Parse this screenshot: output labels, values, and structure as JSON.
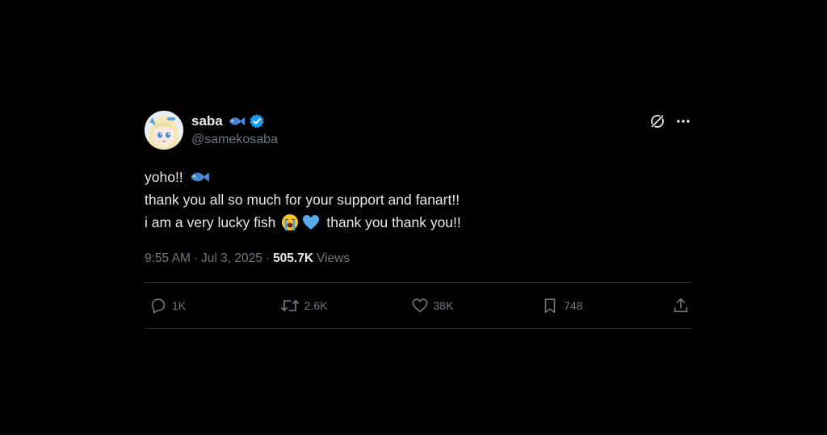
{
  "user": {
    "display_name": "saba",
    "handle": "@samekosaba",
    "verified": true
  },
  "tweet": {
    "lines": [
      {
        "text": "yoho!!",
        "emoji_after": [
          "fish-icon"
        ]
      },
      {
        "text": "thank you all so much for your support and fanart!!"
      },
      {
        "text_before": "i am a very lucky fish",
        "emojis": [
          "loudly-crying-face-icon",
          "blue-heart-icon"
        ],
        "text_after": "thank you thank you!!"
      }
    ],
    "time": "9:55 AM",
    "separator": "·",
    "date": "Jul 3, 2025",
    "views_count": "505.7K",
    "views_label": "Views"
  },
  "actions": {
    "replies": "1K",
    "reposts": "2.6K",
    "likes": "38K",
    "bookmarks": "748"
  },
  "colors": {
    "background": "#000000",
    "text_primary": "#e7e9ea",
    "text_secondary": "#71767b",
    "divider": "#2f3336",
    "verified_blue": "#1d9bf0",
    "fish_blue": "#4a90d9"
  }
}
